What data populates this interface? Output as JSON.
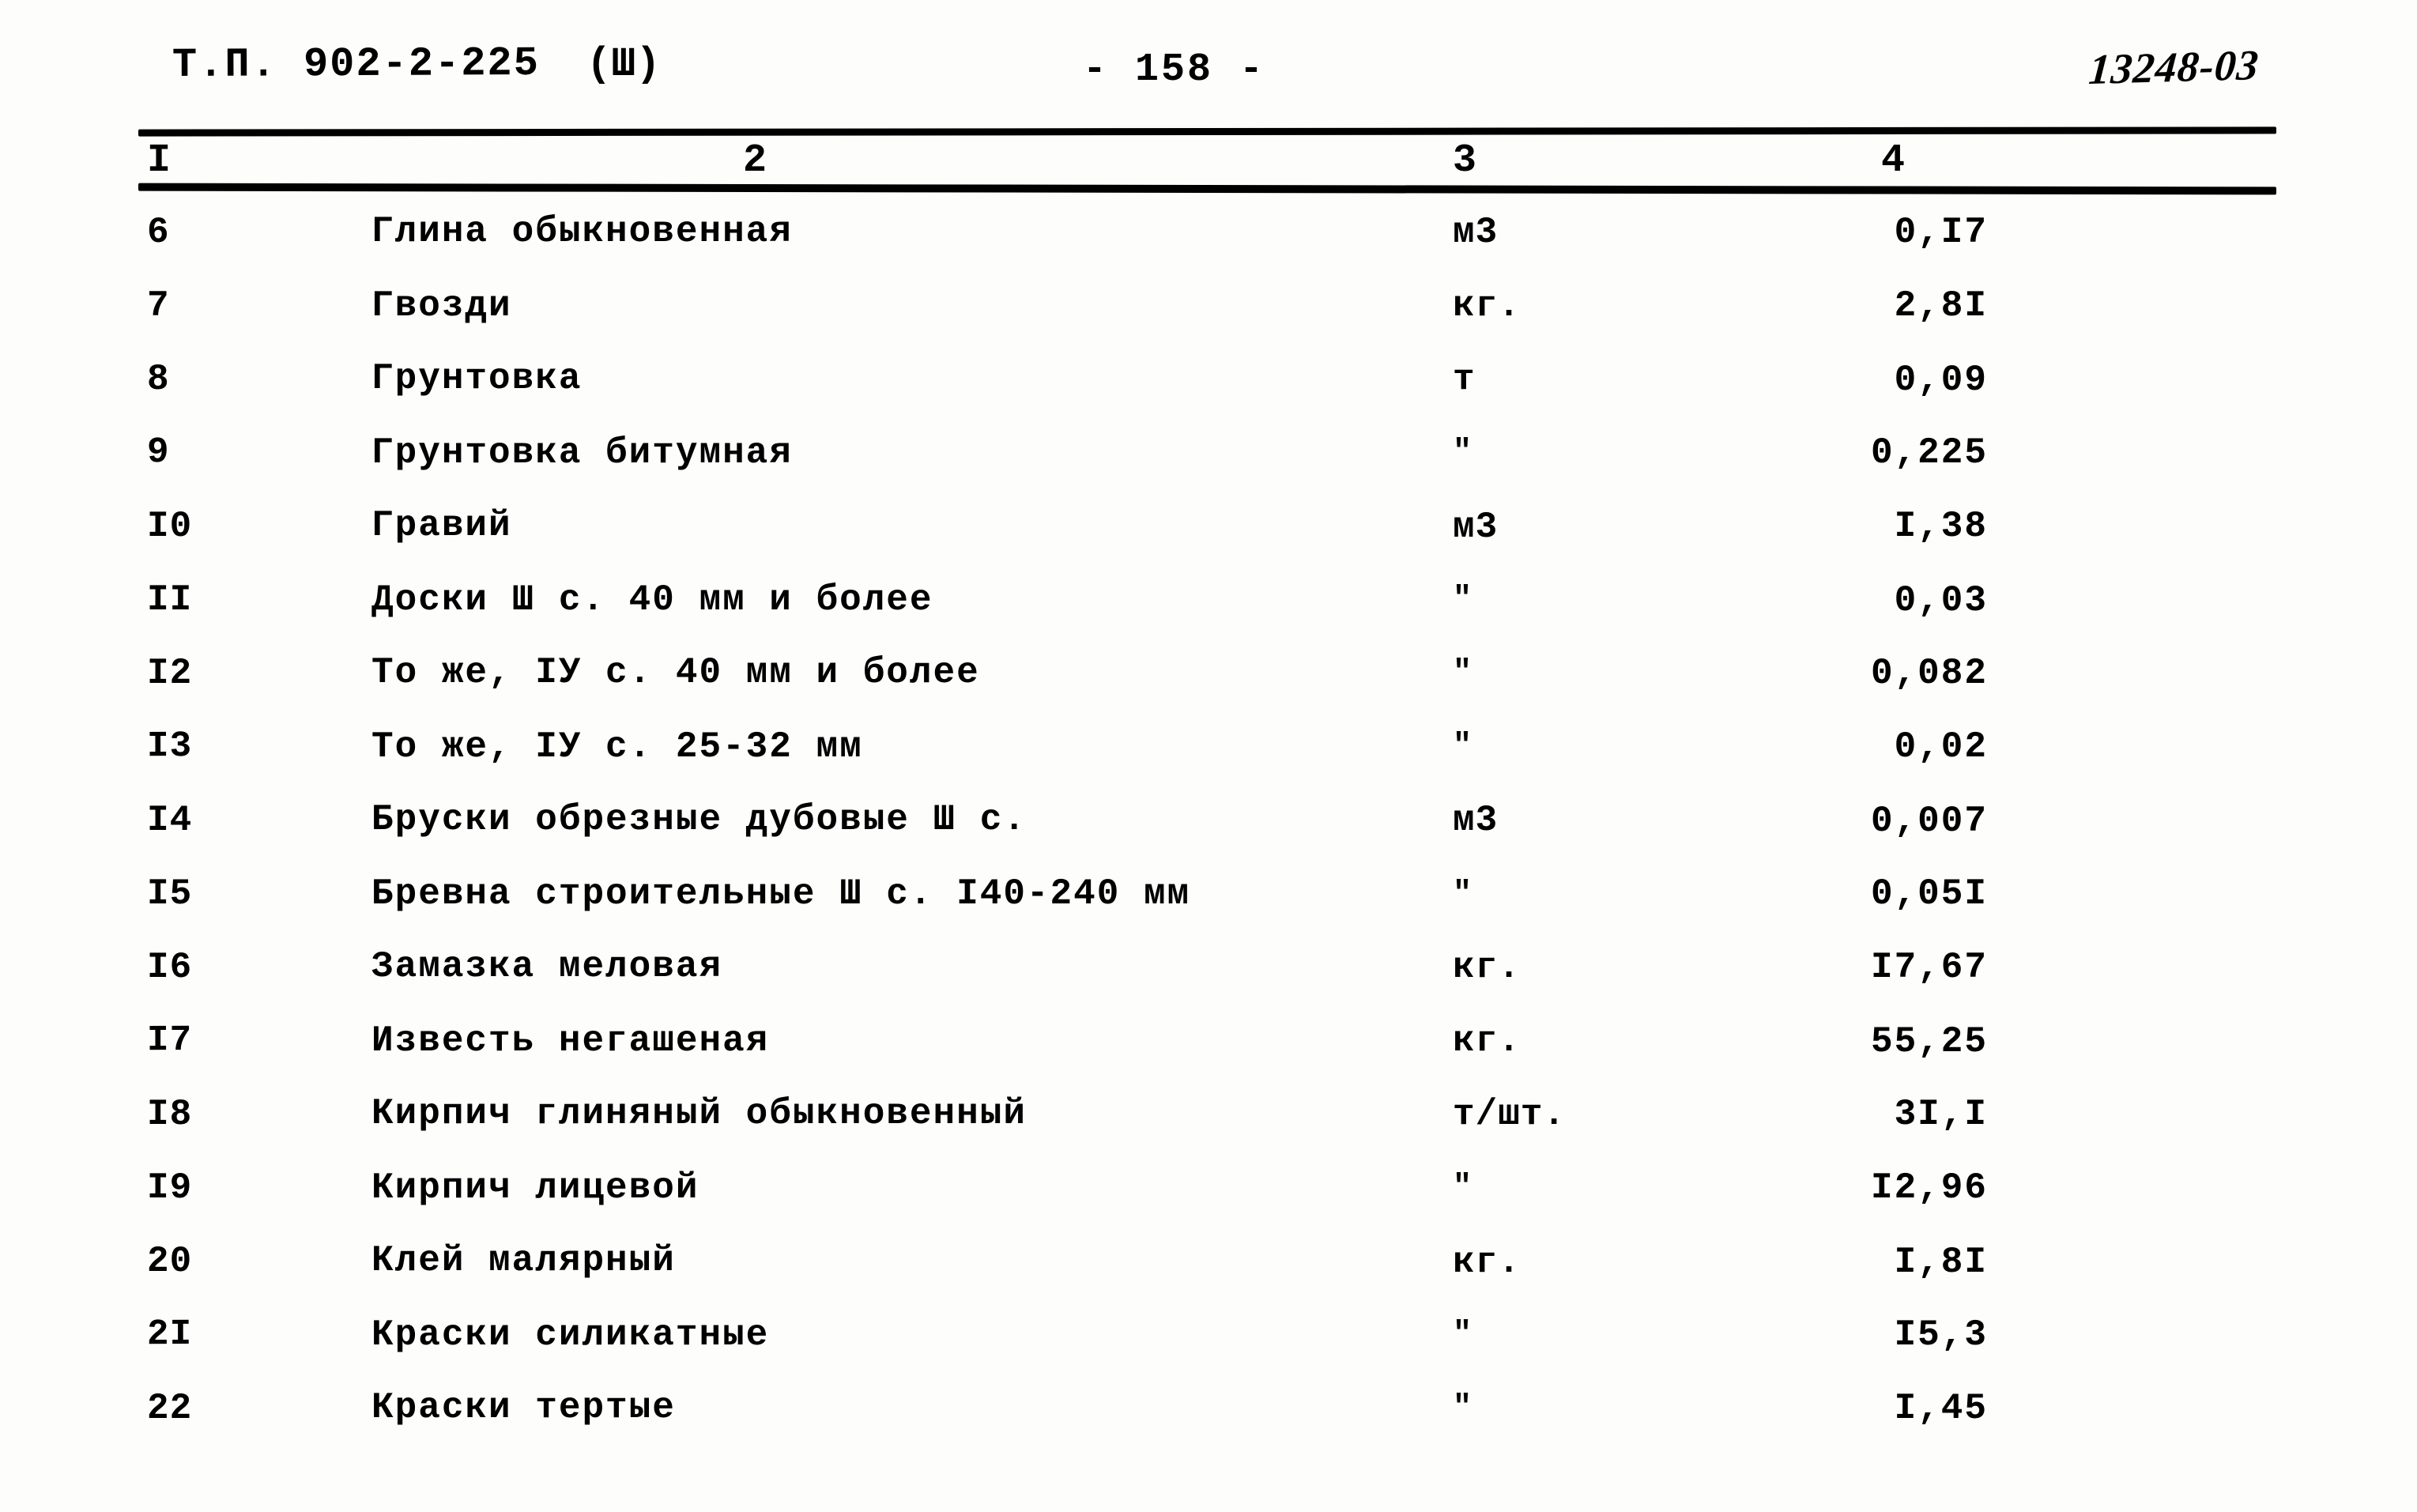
{
  "header": {
    "doc_code": "Т.П. 902-2-225",
    "revision": "(Ш)",
    "page_number": "- 158 -",
    "archive_code": "13248-03"
  },
  "table": {
    "column_numbers": [
      "I",
      "2",
      "3",
      "4"
    ],
    "rows": [
      {
        "num": "6",
        "name": "Глина обыкновенная",
        "unit": "м3",
        "value": "0,I7"
      },
      {
        "num": "7",
        "name": "Гвозди",
        "unit": "кг.",
        "value": "2,8I"
      },
      {
        "num": "8",
        "name": "Грунтовка",
        "unit": "т",
        "value": "0,09"
      },
      {
        "num": "9",
        "name": "Грунтовка битумная",
        "unit": "\"",
        "value": "0,225"
      },
      {
        "num": "I0",
        "name": "Гравий",
        "unit": "м3",
        "value": "I,38"
      },
      {
        "num": "II",
        "name": "Доски Ш с. 40 мм и более",
        "unit": "\"",
        "value": "0,03"
      },
      {
        "num": "I2",
        "name": "То же, IУ с. 40 мм и более",
        "unit": "\"",
        "value": "0,082"
      },
      {
        "num": "I3",
        "name": "То же, IУ с. 25-32 мм",
        "unit": "\"",
        "value": "0,02"
      },
      {
        "num": "I4",
        "name": "Бруски обрезные дубовые Ш с.",
        "unit": "м3",
        "value": "0,007"
      },
      {
        "num": "I5",
        "name": "Бревна строительные Ш с. I40-240 мм",
        "unit": "\"",
        "value": "0,05I"
      },
      {
        "num": "I6",
        "name": "Замазка меловая",
        "unit": "кг.",
        "value": "I7,67"
      },
      {
        "num": "I7",
        "name": "Известь негашеная",
        "unit": "кг.",
        "value": "55,25"
      },
      {
        "num": "I8",
        "name": "Кирпич глиняный обыкновенный",
        "unit": "т/шт.",
        "value": "3I,I"
      },
      {
        "num": "I9",
        "name": "Кирпич лицевой",
        "unit": "\"",
        "value": "I2,96"
      },
      {
        "num": "20",
        "name": "Клей малярный",
        "unit": "кг.",
        "value": "I,8I"
      },
      {
        "num": "2I",
        "name": "Краски силикатные",
        "unit": "\"",
        "value": "I5,3"
      },
      {
        "num": "22",
        "name": "Краски тертые",
        "unit": "\"",
        "value": "I,45"
      }
    ]
  }
}
